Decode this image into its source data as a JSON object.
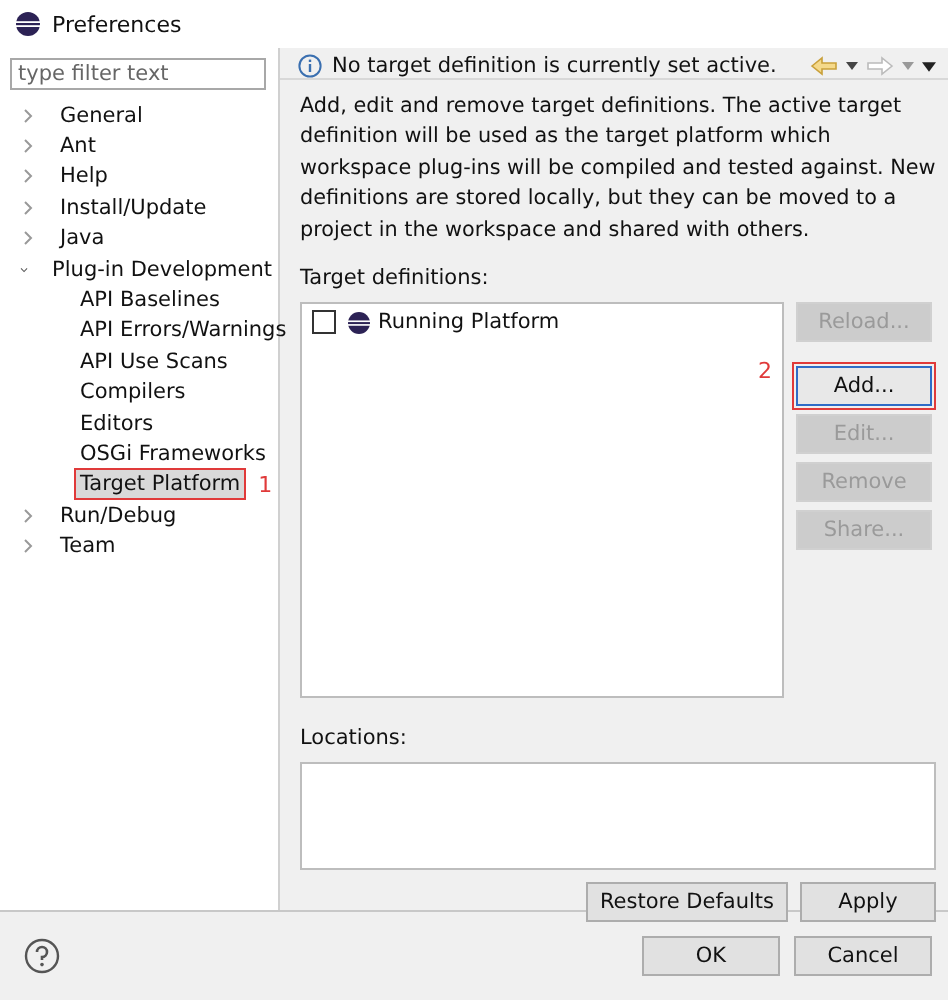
{
  "window": {
    "title": "Preferences"
  },
  "filter": {
    "placeholder": "type filter text"
  },
  "tree": [
    {
      "label": "General",
      "expanded": false,
      "selected": false
    },
    {
      "label": "Ant",
      "expanded": false,
      "selected": false
    },
    {
      "label": "Help",
      "expanded": false,
      "selected": false
    },
    {
      "label": "Install/Update",
      "expanded": false,
      "selected": false
    },
    {
      "label": "Java",
      "expanded": false,
      "selected": false
    },
    {
      "label": "Plug-in Development",
      "expanded": true,
      "selected": false,
      "children": [
        {
          "label": "API Baselines",
          "selected": false
        },
        {
          "label": "API Errors/Warnings",
          "selected": false
        },
        {
          "label": "API Use Scans",
          "selected": false
        },
        {
          "label": "Compilers",
          "selected": false
        },
        {
          "label": "Editors",
          "selected": false
        },
        {
          "label": "OSGi Frameworks",
          "selected": false
        },
        {
          "label": "Target Platform",
          "selected": true,
          "annotation": "1"
        }
      ]
    },
    {
      "label": "Run/Debug",
      "expanded": false,
      "selected": false
    },
    {
      "label": "Team",
      "expanded": false,
      "selected": false
    }
  ],
  "page": {
    "message": "No target definition is currently set active.",
    "description": "Add, edit and remove target definitions.  The active target definition will be used as the target platform which workspace plug-ins will be compiled and tested against.  New definitions are stored locally, but they can be moved to a project in the workspace and shared with others.",
    "definitions_label": "Target definitions:",
    "definitions": [
      {
        "label": "Running Platform",
        "checked": false
      }
    ],
    "buttons": [
      {
        "label": "Reload...",
        "disabled": true
      },
      {
        "label": "Add...",
        "disabled": false,
        "annotation": "2"
      },
      {
        "label": "Edit...",
        "disabled": true
      },
      {
        "label": "Remove",
        "disabled": true
      },
      {
        "label": "Share...",
        "disabled": true
      }
    ],
    "locations_label": "Locations:",
    "page_buttons": [
      "Restore Defaults",
      "Apply"
    ]
  },
  "dialog_buttons": [
    "OK",
    "Cancel"
  ]
}
